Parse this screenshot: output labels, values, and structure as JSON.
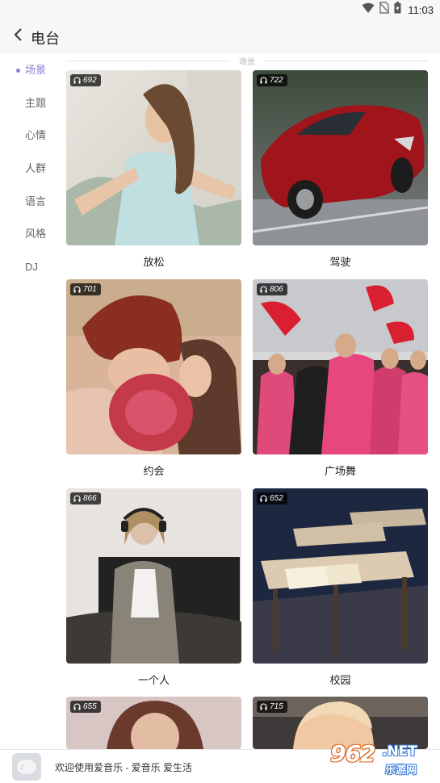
{
  "status_bar": {
    "time": "11:03",
    "icons": [
      "wifi-icon",
      "no-sim-icon",
      "battery-icon"
    ]
  },
  "header": {
    "back_icon": "chevron-left-icon",
    "title": "电台"
  },
  "sidebar": {
    "active_color": "#8b7fd9",
    "items": [
      {
        "label": "场景",
        "active": true
      },
      {
        "label": "主题",
        "active": false
      },
      {
        "label": "心情",
        "active": false
      },
      {
        "label": "人群",
        "active": false
      },
      {
        "label": "语言",
        "active": false
      },
      {
        "label": "风格",
        "active": false
      },
      {
        "label": "DJ",
        "active": false
      }
    ]
  },
  "section": {
    "label": "场景"
  },
  "cards": [
    {
      "title": "放松",
      "count": "692",
      "icon": "headphones-icon",
      "image": "woman-relaxing-photo"
    },
    {
      "title": "驾驶",
      "count": "722",
      "icon": "headphones-icon",
      "image": "red-sports-car-photo"
    },
    {
      "title": "约会",
      "count": "701",
      "icon": "headphones-icon",
      "image": "couple-kissing-photo"
    },
    {
      "title": "广场舞",
      "count": "806",
      "icon": "headphones-icon",
      "image": "square-dance-photo"
    },
    {
      "title": "一个人",
      "count": "866",
      "icon": "headphones-icon",
      "image": "woman-headphones-photo"
    },
    {
      "title": "校园",
      "count": "652",
      "icon": "headphones-icon",
      "image": "classroom-desks-photo"
    },
    {
      "title": "",
      "count": "655",
      "icon": "headphones-icon",
      "image": "woman-portrait-photo"
    },
    {
      "title": "",
      "count": "715",
      "icon": "headphones-icon",
      "image": "blonde-girl-photo"
    }
  ],
  "banner": {
    "text": "欢迎使用爱音乐 - 爱音乐 爱生活",
    "watermark_number": "962",
    "watermark_domain": ".NET",
    "watermark_cn": "乐游网"
  }
}
